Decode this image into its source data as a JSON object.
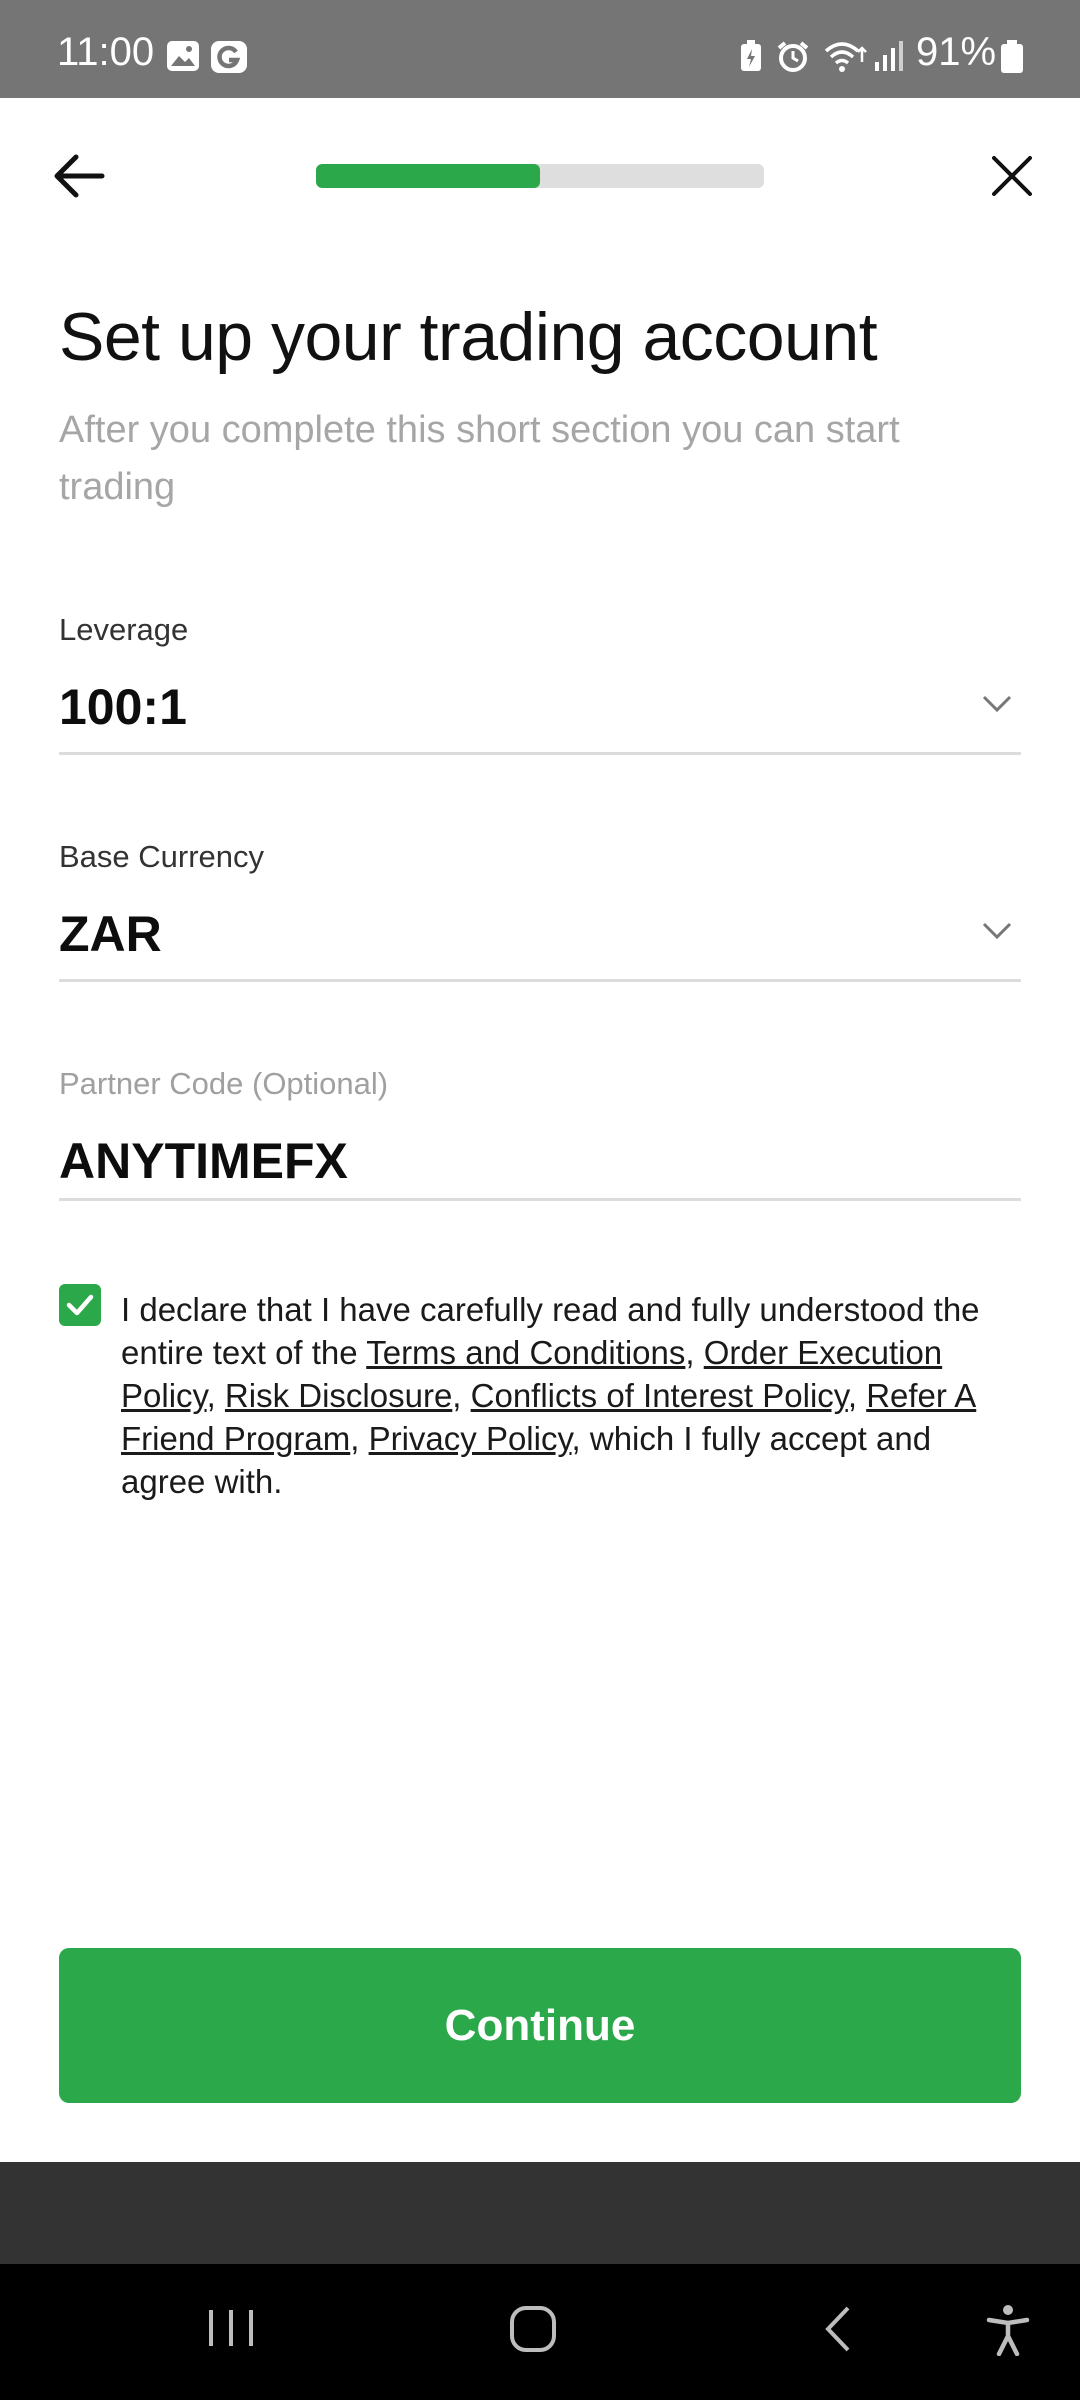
{
  "status_bar": {
    "time": "11:00",
    "battery": "91%",
    "icons": [
      "image-icon",
      "g-icon",
      "battery-saver-icon",
      "alarm-icon",
      "wifi-icon",
      "signal-icon",
      "battery-icon"
    ]
  },
  "header": {
    "progress_percent": 50,
    "back_icon": "arrow-left-icon",
    "close_icon": "close-icon",
    "progress_color": "#2ba84a"
  },
  "page": {
    "title": "Set up your trading account",
    "subtitle": "After you complete this short section you can start trading"
  },
  "fields": {
    "leverage": {
      "label": "Leverage",
      "value": "100:1"
    },
    "base_currency": {
      "label": "Base Currency",
      "value": "ZAR"
    },
    "partner_code": {
      "label": "Partner Code (Optional)",
      "value": "ANYTIMEFX"
    }
  },
  "declaration": {
    "checked": true,
    "intro": "I declare that I have carefully read and fully understood the entire text of the ",
    "links": [
      "Terms and Conditions",
      "Order Execution Policy",
      "Risk Disclosure",
      "Conflicts of Interest Policy",
      "Refer A Friend Program",
      "Privacy Policy"
    ],
    "separator": ", ",
    "outro": ", which I fully accept and agree with."
  },
  "actions": {
    "continue_label": "Continue",
    "accent_color": "#2ba84a"
  },
  "nav_bar": {
    "buttons": [
      "recent-apps-icon",
      "home-icon",
      "back-nav-icon",
      "accessibility-icon"
    ]
  }
}
